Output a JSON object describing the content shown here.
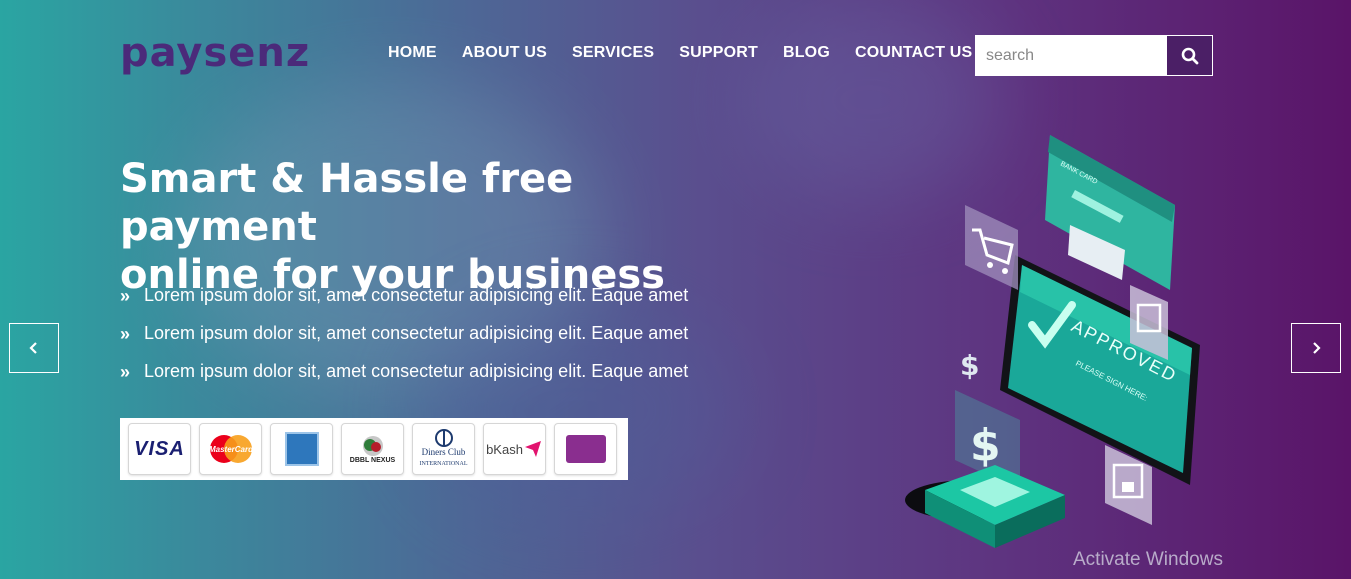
{
  "brand": {
    "logo": "paysenz"
  },
  "nav": {
    "items": [
      {
        "label": "HOME"
      },
      {
        "label": "ABOUT US"
      },
      {
        "label": "SERVICES"
      },
      {
        "label": "SUPPORT"
      },
      {
        "label": "BLOG"
      },
      {
        "label": "COUNTACT US"
      }
    ]
  },
  "search": {
    "placeholder": "search",
    "value": ""
  },
  "hero": {
    "headline_line1": "Smart & Hassle free payment",
    "headline_line2": "online for your business",
    "bullets": [
      "Lorem ipsum dolor sit, amet consectetur adipisicing elit. Eaque amet",
      "Lorem ipsum dolor sit, amet consectetur adipisicing elit. Eaque amet",
      "Lorem ipsum dolor sit, amet consectetur adipisicing elit. Eaque amet"
    ]
  },
  "payment_methods": {
    "visa": "VISA",
    "mastercard": "MasterCard",
    "amex": "AMERICAN EXPRESS",
    "dbbl": "DBBL NEXUS",
    "diners_line1": "Diners Club",
    "diners_line2": "INTERNATIONAL",
    "bkash": "bKash",
    "rocket_icon": "rocket-logo"
  },
  "illustration": {
    "screen_text": "APPROVED",
    "screen_subtext": "PLEASE SIGN HERE:",
    "card_label": "BANK CARD"
  },
  "watermark": "Activate Windows",
  "colors": {
    "brand": "#4b2a7a",
    "search_button": "#4b1f66",
    "gradient_start": "#2aa5a2",
    "gradient_end": "#5a1468",
    "accent_teal": "#2fd1b0"
  }
}
